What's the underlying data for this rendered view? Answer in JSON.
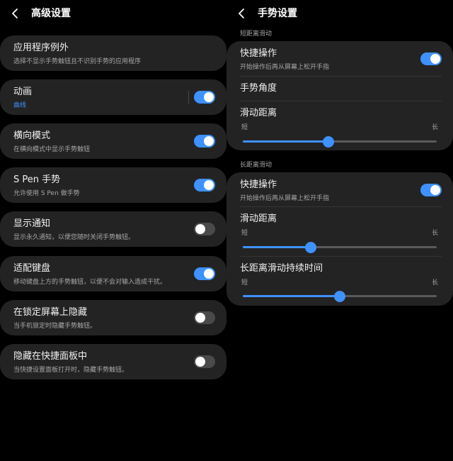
{
  "left": {
    "title": "高级设置",
    "items": [
      {
        "title": "应用程序例外",
        "subtitle": "选择不显示手势触钮且不识别手势的应用程序",
        "toggle": null
      },
      {
        "title": "动画",
        "subtitle": "曲线",
        "toggle": true
      },
      {
        "title": "横向模式",
        "subtitle": "在横向模式中显示手势触钮",
        "toggle": true
      },
      {
        "title": "S Pen 手势",
        "subtitle": "允许使用 S Pen 做手势",
        "toggle": true
      },
      {
        "title": "显示通知",
        "subtitle": "显示永久通知，以便您随时关闭手势触钮。",
        "toggle": false
      },
      {
        "title": "适配键盘",
        "subtitle": "移动键盘上方的手势触钮，以便不会对输入造成干扰。",
        "toggle": true
      },
      {
        "title": "在锁定屏幕上隐藏",
        "subtitle": "当手机锁定时隐藏手势触钮。",
        "toggle": false
      },
      {
        "title": "隐藏在快捷面板中",
        "subtitle": "当快捷设置面板打开时，隐藏手势触钮。",
        "toggle": false
      }
    ]
  },
  "right": {
    "title": "手势设置",
    "short": {
      "label": "短距离滑动",
      "quick": {
        "title": "快捷操作",
        "subtitle": "开始操作后再从屏幕上松开手指",
        "toggle": true
      },
      "angle": {
        "title": "手势角度"
      },
      "distance": {
        "title": "滑动距离",
        "min_label": "短",
        "max_label": "长",
        "value": 0.44
      }
    },
    "long": {
      "label": "长距离滑动",
      "quick": {
        "title": "快捷操作",
        "subtitle": "开始操作后再从屏幕上松开手指",
        "toggle": true
      },
      "distance": {
        "title": "滑动距离",
        "min_label": "短",
        "max_label": "长",
        "value": 0.35
      },
      "duration": {
        "title": "长距离滑动持续时间",
        "min_label": "短",
        "max_label": "长",
        "value": 0.5
      }
    }
  },
  "colors": {
    "accent": "#3e91ff",
    "card": "#232323",
    "background": "#000000"
  },
  "icons": {
    "back": "chevron-left-icon"
  }
}
